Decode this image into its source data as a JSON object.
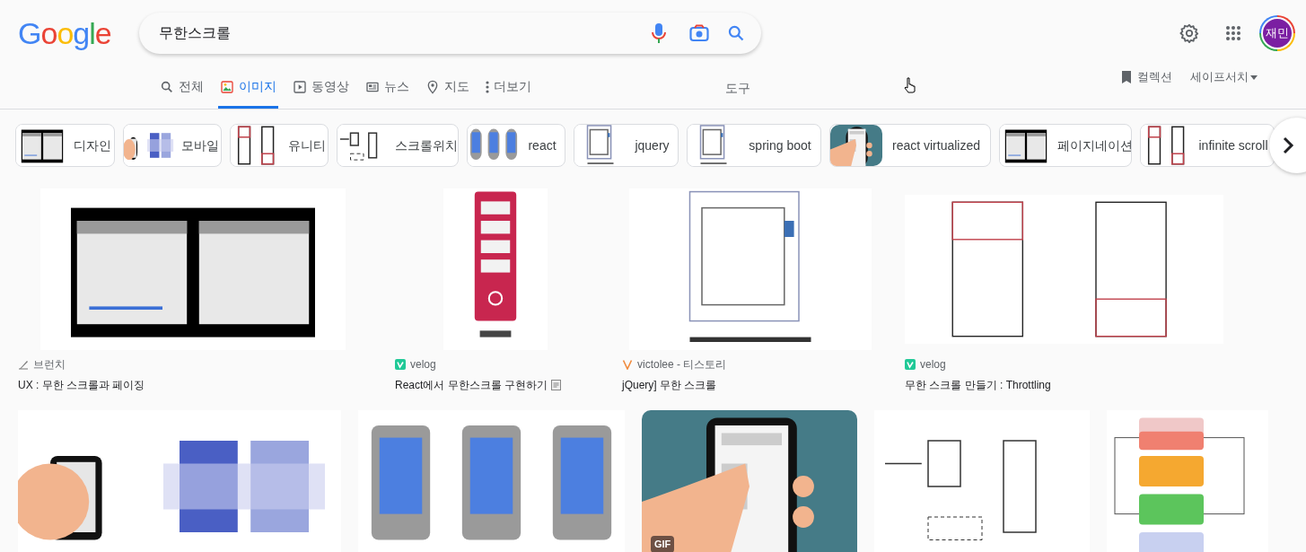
{
  "logo": "Google",
  "search": {
    "value": "무한스크롤"
  },
  "tabs": [
    {
      "label": "전체",
      "selected": false
    },
    {
      "label": "이미지",
      "selected": true
    },
    {
      "label": "동영상",
      "selected": false
    },
    {
      "label": "뉴스",
      "selected": false
    },
    {
      "label": "지도",
      "selected": false
    },
    {
      "label": "더보기",
      "selected": false
    }
  ],
  "tools": "도구",
  "collections": "컬렉션",
  "safesearch": "세이프서치",
  "avatar": "재민",
  "chips": [
    "디자인",
    "모바일",
    "유니티",
    "스크롤위치",
    "react",
    "jquery",
    "spring boot",
    "react virtualized",
    "페이지네이션",
    "infinite scroll"
  ],
  "results": [
    {
      "source": "브런치",
      "kind": "brunch",
      "title": "UX : 무한 스크롤과 페이징",
      "doc_icon": false
    },
    {
      "source": "velog",
      "kind": "velog",
      "title": "React에서 무한스크롤 구현하기",
      "doc_icon": true
    },
    {
      "source": "victolee - 티스토리",
      "kind": "tistory",
      "title": "jQuery] 무한 스크롤",
      "doc_icon": false
    },
    {
      "source": "velog",
      "kind": "velog",
      "title": "무한 스크롤 만들기 : Throttling",
      "doc_icon": false
    }
  ],
  "more_results": [
    {
      "kind": "picture"
    },
    {
      "kind": "picture"
    },
    {
      "kind": "picture",
      "badge": "GIF"
    },
    {
      "kind": "picture"
    },
    {
      "kind": "picture"
    }
  ]
}
